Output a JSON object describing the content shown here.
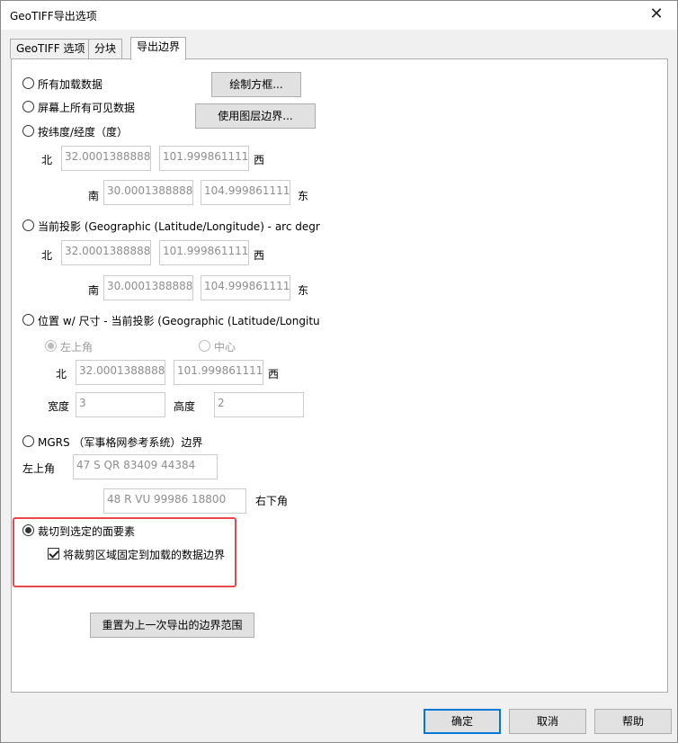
{
  "window": {
    "title": "GeoTIFF导出选项",
    "close_glyph": "✕"
  },
  "tabs": [
    {
      "label": "GeoTIFF 选项"
    },
    {
      "label": "分块"
    },
    {
      "label": "导出边界"
    }
  ],
  "bounds": {
    "opt_all_loaded": "所有加载数据",
    "opt_visible": "屏幕上所有可见数据",
    "btn_draw_box": "绘制方框...",
    "btn_use_layer": "使用图层边界...",
    "opt_latlon": "按纬度/经度（度）",
    "latlon": {
      "north_label": "北",
      "north": "32.00013888888",
      "west": "101.9998611111",
      "west_label": "西",
      "south_label": "南",
      "south": "30.00013888888",
      "east": "104.9998611111",
      "east_label": "东"
    },
    "opt_projection": "当前投影 (Geographic (Latitude/Longitude) - arc degre",
    "proj": {
      "north_label": "北",
      "north": "32.00013888888",
      "west": "101.9998611111",
      "west_label": "西",
      "south_label": "南",
      "south": "30.00013888888",
      "east": "104.9998611111",
      "east_label": "东"
    },
    "opt_position": "位置 w/ 尺寸 - 当前投影 (Geographic (Latitude/Longitud",
    "position": {
      "anchor_top_left": "左上角",
      "anchor_center": "中心",
      "north_label": "北",
      "north": "32.00013888888",
      "west": "101.9998611111",
      "west_label": "西",
      "width_label": "宽度",
      "width": "3",
      "height_label": "高度",
      "height": "2"
    },
    "opt_mgrs": "MGRS （军事格网参考系统）边界",
    "mgrs": {
      "top_left_label": "左上角",
      "top_left": "47 S QR 83409 44384",
      "bottom_right": "48 R VU 99986 18800",
      "bottom_right_label": "右下角"
    },
    "opt_crop": "裁切到选定的面要素",
    "chk_fix_crop": "将裁剪区域固定到加载的数据边界",
    "btn_reset": "重置为上一次导出的边界范围"
  },
  "footer": {
    "ok": "确定",
    "cancel": "取消",
    "help": "帮助"
  },
  "colors": {
    "highlight": "#e8474b",
    "default_button_border": "#0078d7"
  }
}
